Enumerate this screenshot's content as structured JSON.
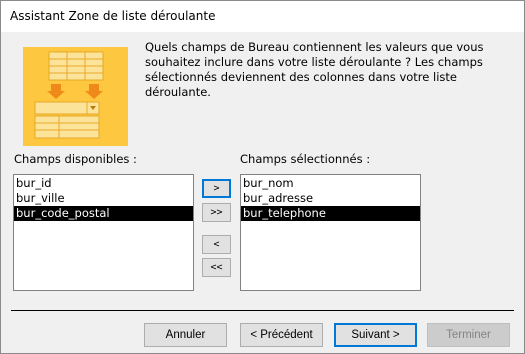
{
  "window": {
    "title": "Assistant Zone de liste déroulante"
  },
  "illustration": {
    "icon": "combo-box-wizard-icon",
    "color": "#fdc740"
  },
  "description": "Quels champs de Bureau contiennent les valeurs que vous souhaitez inclure dans votre liste déroulante ? Les champs sélectionnés deviennent des colonnes dans votre liste déroulante.",
  "available": {
    "label": "Champs disponibles :",
    "items": [
      {
        "text": "bur_id",
        "selected": false
      },
      {
        "text": "bur_ville",
        "selected": false
      },
      {
        "text": "bur_code_postal",
        "selected": true
      }
    ]
  },
  "selected_fields": {
    "label": "Champs sélectionnés :",
    "items": [
      {
        "text": "bur_nom",
        "selected": false
      },
      {
        "text": "bur_adresse",
        "selected": false
      },
      {
        "text": "bur_telephone",
        "selected": true
      }
    ]
  },
  "move_buttons": {
    "add_one": ">",
    "add_all": ">>",
    "remove_one": "<",
    "remove_all": "<<"
  },
  "footer": {
    "cancel": "Annuler",
    "back": "< Précédent",
    "next": "Suivant >",
    "finish": "Terminer"
  }
}
